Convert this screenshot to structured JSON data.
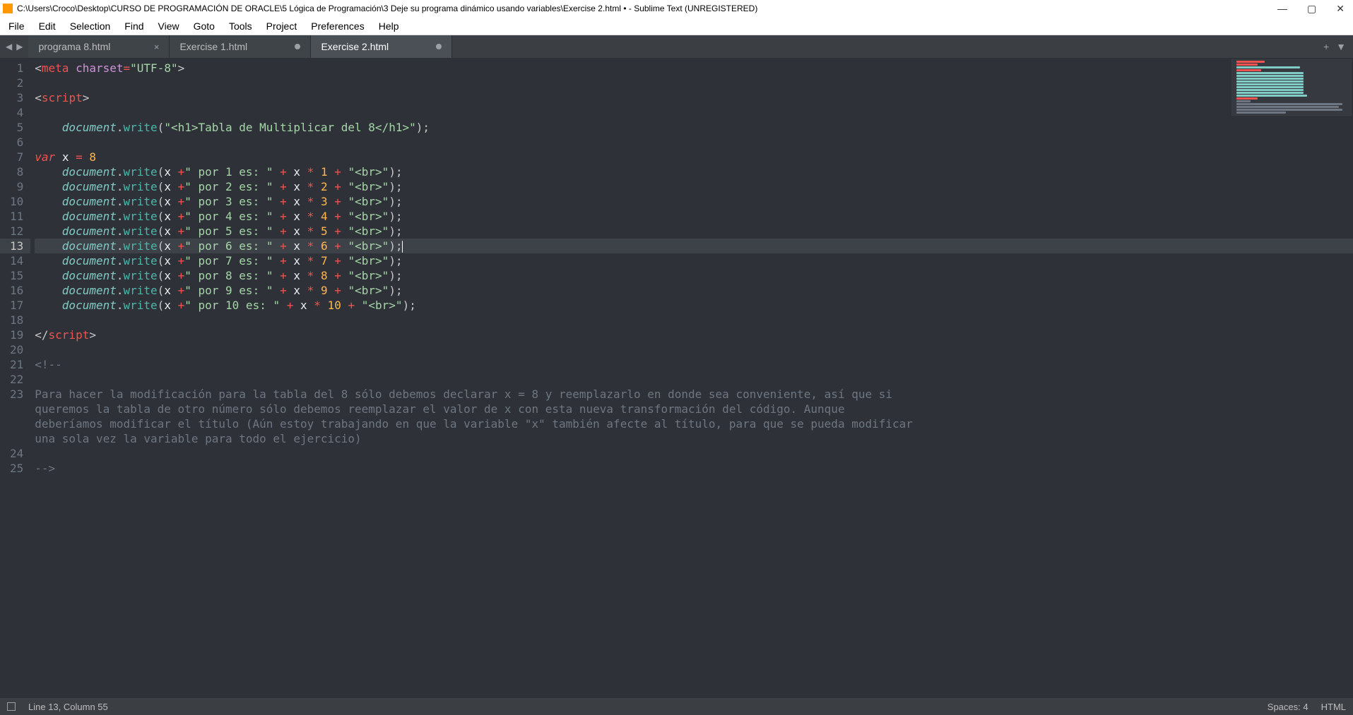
{
  "window": {
    "title": "C:\\Users\\Croco\\Desktop\\CURSO DE PROGRAMACIÓN DE ORACLE\\5 Lógica de Programación\\3 Deje su programa dinámico usando variables\\Exercise 2.html • - Sublime Text (UNREGISTERED)"
  },
  "menu": {
    "items": [
      "File",
      "Edit",
      "Selection",
      "Find",
      "View",
      "Goto",
      "Tools",
      "Project",
      "Preferences",
      "Help"
    ]
  },
  "tabs": [
    {
      "label": "programa 8.html",
      "close": "×",
      "dirty": false
    },
    {
      "label": "Exercise 1.html",
      "close": "",
      "dirty": true
    },
    {
      "label": "Exercise 2.html",
      "close": "",
      "dirty": true,
      "active": true
    }
  ],
  "status": {
    "pos": "Line 13, Column 55",
    "spaces": "Spaces: 4",
    "syntax": "HTML"
  },
  "code": {
    "l1": {
      "p1": "<",
      "tag": "meta",
      "sp": " ",
      "attr": "charset",
      "eq": "=",
      "str": "\"UTF-8\"",
      "p2": ">"
    },
    "l3": {
      "p1": "<",
      "tag": "script",
      "p2": ">"
    },
    "l5": {
      "obj": "document",
      "dot": ".",
      "meth": "write",
      "op1": "(",
      "str": "\"<h1>Tabla de Multiplicar del 8</h1>\"",
      "op2": ")",
      "sc": ";"
    },
    "l7": {
      "kw": "var",
      "sp": " ",
      "v": "x",
      "sp2": " ",
      "eq": "=",
      "sp3": " ",
      "num": "8"
    },
    "mul": [
      {
        "n": "1"
      },
      {
        "n": "2"
      },
      {
        "n": "3"
      },
      {
        "n": "4"
      },
      {
        "n": "5"
      },
      {
        "n": "6"
      },
      {
        "n": "7"
      },
      {
        "n": "8"
      },
      {
        "n": "9"
      }
    ],
    "mul10": {
      "n": "10"
    },
    "mulCommon": {
      "obj": "document",
      "dot": ".",
      "meth": "write",
      "op1": "(",
      "v": "x",
      "sp1": " ",
      "plus": "+",
      "strA": "\" por ",
      "strB": " es: \"",
      "sp2": " ",
      "plus2": "+",
      "sp3": " ",
      "v2": "x",
      "sp4": " ",
      "star": "*",
      "sp5": " ",
      "sp6": " ",
      "plus3": "+",
      "sp7": " ",
      "strBr": "\"<br>\"",
      "op2": ")",
      "sc": ";"
    },
    "l19": {
      "p1": "</",
      "tag": "script",
      "p2": ">"
    },
    "l21": "<!--",
    "l23": "Para hacer la modificación para la tabla del 8 sólo debemos declarar x = 8 y reemplazarlo en donde sea conveniente, así que si \nqueremos la tabla de otro número sólo debemos reemplazar el valor de x con esta nueva transformación del código. Aunque \ndeberíamos modificar el título (Aún estoy trabajando en que la variable \"x\" también afecte al título, para que se pueda modificar \nuna sola vez la variable para todo el ejercicio)",
    "l25": "-->"
  },
  "lineNumbers": [
    1,
    2,
    3,
    4,
    5,
    6,
    7,
    8,
    9,
    10,
    11,
    12,
    13,
    14,
    15,
    16,
    17,
    18,
    19,
    20,
    21,
    22,
    23,
    24,
    25
  ],
  "highlightLine": 13
}
